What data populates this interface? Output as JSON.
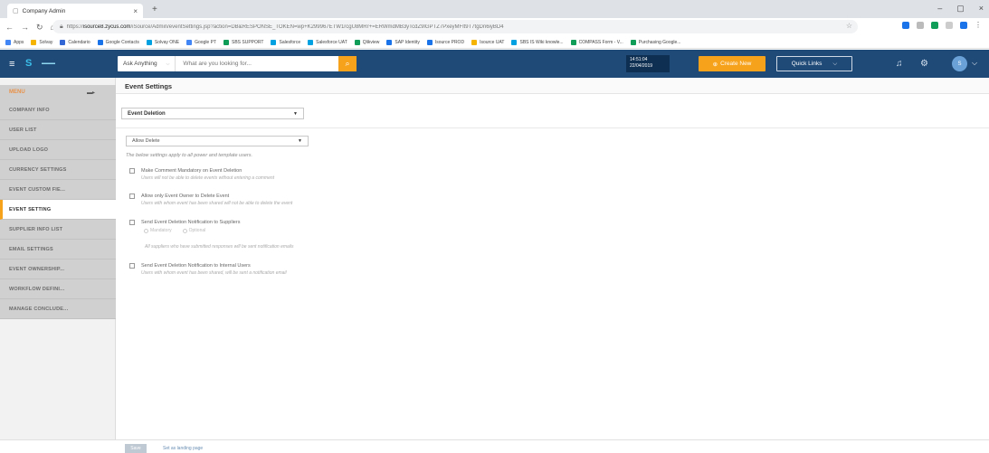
{
  "browser": {
    "tab_title": "Company Admin",
    "tab_close": "×",
    "new_tab": "+",
    "window_controls": [
      "–",
      "▢",
      "×"
    ],
    "url_prefix": "https://",
    "url_host": "isource8.zycus.com",
    "url_path": "/iSource/Admin/eventSettings.jsp?action=DB&RESPONSE_TOKEN=wp+K299967ETW1rcgU8MRr+=ERWmdMB3yTcdZ9lGPTZ7PxeyMFlt9T7tgDn6iyBD4",
    "bookmarks": [
      {
        "label": "Apps",
        "color": "#4285f4"
      },
      {
        "label": "Solvay",
        "color": "#f4b400"
      },
      {
        "label": "Calendario",
        "color": "#3367d6"
      },
      {
        "label": "Google Contacts",
        "color": "#1a73e8"
      },
      {
        "label": "Solvay ONE",
        "color": "#00a1e0"
      },
      {
        "label": "Google PT",
        "color": "#4285f4"
      },
      {
        "label": "SBS SUPPORT",
        "color": "#0f9d58"
      },
      {
        "label": "Salesforce",
        "color": "#00a1e0"
      },
      {
        "label": "Salesforce UAT",
        "color": "#00a1e0"
      },
      {
        "label": "Qlikview",
        "color": "#0f9d58"
      },
      {
        "label": "SAP Identity",
        "color": "#1a73e8"
      },
      {
        "label": "Isource PROD",
        "color": "#1a73e8"
      },
      {
        "label": "Isource UAT",
        "color": "#f4b400"
      },
      {
        "label": "SBS IS Wiki knowle...",
        "color": "#00a1e0"
      },
      {
        "label": "COMPASS Form - V...",
        "color": "#0f9d58"
      },
      {
        "label": "Purchasing Google...",
        "color": "#0f9d58"
      }
    ]
  },
  "header": {
    "ask_anything": "Ask Anything",
    "search_placeholder": "What are you looking for...",
    "time": "14:51:04",
    "date": "22/04/2019",
    "create_new": "Create New",
    "quick_links": "Quick Links",
    "avatar_initial": "S"
  },
  "sidebar": {
    "menu_label": "MENU",
    "items": [
      {
        "label": "COMPANY INFO",
        "active": false
      },
      {
        "label": "USER LIST",
        "active": false
      },
      {
        "label": "UPLOAD LOGO",
        "active": false
      },
      {
        "label": "CURRENCY SETTINGS",
        "active": false
      },
      {
        "label": "EVENT CUSTOM FIE...",
        "active": false
      },
      {
        "label": "EVENT SETTING",
        "active": true
      },
      {
        "label": "SUPPLIER INFO LIST",
        "active": false
      },
      {
        "label": "EMAIL SETTINGS",
        "active": false
      },
      {
        "label": "EVENT OWNERSHIP...",
        "active": false
      },
      {
        "label": "WORKFLOW DEFINI...",
        "active": false
      },
      {
        "label": "MANAGE CONCLUDE...",
        "active": false
      }
    ]
  },
  "main": {
    "title": "Event Settings",
    "event_select": "Event Deletion",
    "delete_select": "Allow Delete",
    "note": "The below settings apply to all power and template users.",
    "options": [
      {
        "title": "Make Comment Mandatory on Event Deletion",
        "desc": "Users will not be able to delete events without entering a comment"
      },
      {
        "title": "Allow only Event Owner to Delete Event",
        "desc": "Users with whom event has been shared will not be able to delete the event"
      },
      {
        "title": "Send Event Deletion Notification to Suppliers",
        "desc": ""
      },
      {
        "title": "Send Event Deletion Notification to Internal Users",
        "desc": "Users with whom event has been shared, will be sent a notification email"
      }
    ],
    "radio_mandatory": "Mandatory",
    "radio_optional": "Optional",
    "supplier_note": "All suppliers who have submitted responses will be sent notification emails"
  },
  "footer": {
    "save": "Save",
    "landing": "Set as landing page"
  },
  "colors": {
    "header_bg": "#1f4a78",
    "accent": "#f7a21b",
    "menu_label": "#e8924a"
  }
}
